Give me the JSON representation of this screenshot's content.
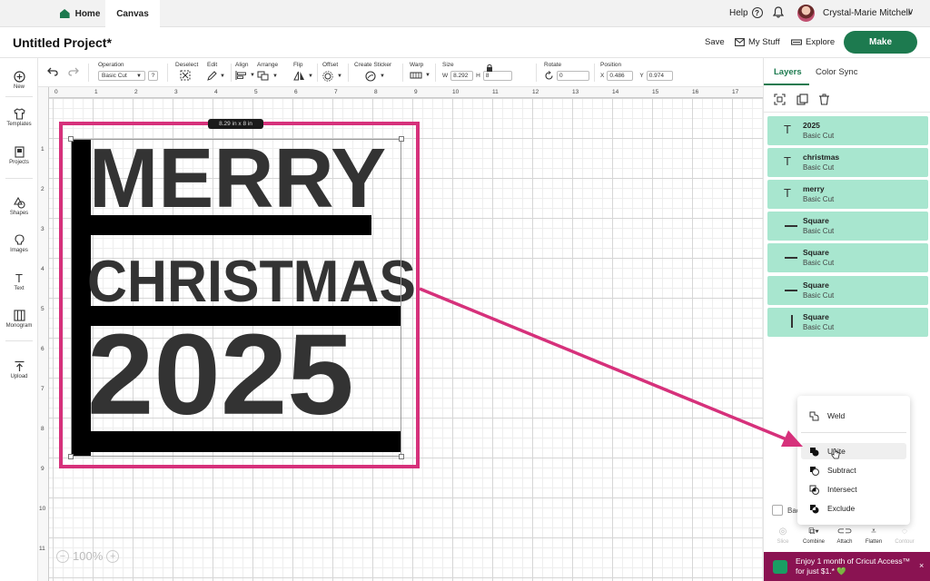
{
  "nav": {
    "home": "Home",
    "canvas": "Canvas",
    "help": "Help",
    "help_icon": "?",
    "user_name": "Crystal-Marie Mitchell",
    "chevron": "∨"
  },
  "project": {
    "title": "Untitled Project*",
    "save": "Save",
    "my_stuff": "My Stuff",
    "explore": "Explore",
    "make": "Make"
  },
  "toolbar": {
    "operation_label": "Operation",
    "operation_value": "Basic Cut",
    "operation_help": "?",
    "deselect_label": "Deselect",
    "edit_label": "Edit",
    "align_label": "Align",
    "arrange_label": "Arrange",
    "flip_label": "Flip",
    "offset_label": "Offset",
    "create_sticker_label": "Create Sticker",
    "warp_label": "Warp",
    "size_label": "Size",
    "size_w_label": "W",
    "size_w": "8.292",
    "size_h_label": "H",
    "size_h": "8",
    "rotate_label": "Rotate",
    "rotate_value": "0",
    "position_label": "Position",
    "pos_x_label": "X",
    "pos_x": "0.486",
    "pos_y_label": "Y",
    "pos_y": "0.974"
  },
  "sidebar": {
    "items": [
      {
        "label": "New",
        "icon": "plus-circle-icon"
      },
      {
        "label": "Templates",
        "icon": "shirt-icon"
      },
      {
        "label": "Projects",
        "icon": "projects-icon"
      },
      {
        "label": "Shapes",
        "icon": "shapes-icon"
      },
      {
        "label": "Images",
        "icon": "lightbulb-icon"
      },
      {
        "label": "Text",
        "icon": "text-icon"
      },
      {
        "label": "Monogram",
        "icon": "monogram-icon"
      },
      {
        "label": "Upload",
        "icon": "upload-icon"
      }
    ]
  },
  "ruler": {
    "top": [
      "0",
      "1",
      "2",
      "3",
      "4",
      "5",
      "6",
      "7",
      "8",
      "9",
      "10",
      "11",
      "12",
      "13",
      "14",
      "15",
      "16",
      "17"
    ],
    "left": [
      "1",
      "2",
      "3",
      "4",
      "5",
      "6",
      "7",
      "8",
      "9",
      "10",
      "11"
    ]
  },
  "canvas": {
    "size_tag": "8.29 in x 8 in",
    "line1": "MERRY",
    "line2": "CHRISTMAS",
    "line3": "2025",
    "zoom_minus": "−",
    "zoom": "100%",
    "zoom_plus": "+"
  },
  "panel": {
    "tab_layers": "Layers",
    "tab_colorsync": "Color Sync",
    "text_icon": "T",
    "layers": [
      {
        "name": "2025",
        "sub": "Basic Cut",
        "kind": "text"
      },
      {
        "name": "christmas",
        "sub": "Basic Cut",
        "kind": "text"
      },
      {
        "name": "merry",
        "sub": "Basic Cut",
        "kind": "text"
      },
      {
        "name": "Square",
        "sub": "Basic Cut",
        "kind": "hline"
      },
      {
        "name": "Square",
        "sub": "Basic Cut",
        "kind": "hline"
      },
      {
        "name": "Square",
        "sub": "Basic Cut",
        "kind": "hline"
      },
      {
        "name": "Square",
        "sub": "Basic Cut",
        "kind": "vline"
      }
    ],
    "blank_label": "Bac",
    "bottom_tools": {
      "slice": "Slice",
      "combine": "Combine",
      "attach": "Attach",
      "flatten": "Flatten",
      "contour": "Contour"
    }
  },
  "combine_menu": {
    "weld": "Weld",
    "unite": "Unite",
    "subtract": "Subtract",
    "intersect": "Intersect",
    "exclude": "Exclude"
  },
  "promo": {
    "text": "Enjoy 1 month of Cricut Access™ for just $1.*",
    "heart": "💚",
    "close": "×"
  },
  "colors": {
    "accent": "#1d7a4f",
    "layer_bg": "#a8e6cf",
    "highlight": "#d6317b",
    "promo_bg": "#8a1352"
  }
}
